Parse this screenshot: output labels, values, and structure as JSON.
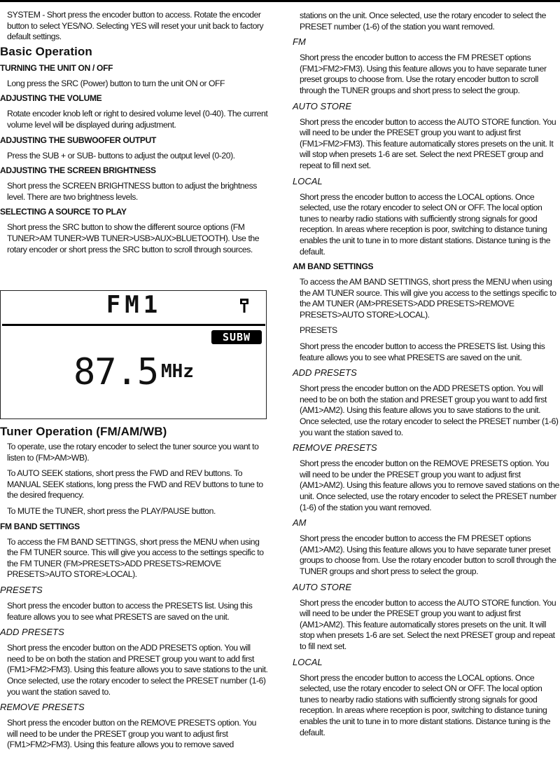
{
  "left": {
    "intro": "SYSTEM - Short press the encoder button to access. Rotate the encoder button to select YES/NO. Selecting YES will reset your unit back to factory default settings.",
    "basic_title": "Basic Operation",
    "basic": [
      {
        "heading": "TURNING THE UNIT ON / OFF",
        "text": "Long press the SRC (Power) button to turn the unit ON or OFF"
      },
      {
        "heading": "ADJUSTING THE VOLUME",
        "text": "Rotate encoder knob left or right to desired volume level (0-40). The current volume level will be displayed during adjustment."
      },
      {
        "heading": "ADJUSTING THE SUBWOOFER OUTPUT",
        "text": "Press the SUB + or SUB- buttons to adjust the output level (0-20)."
      },
      {
        "heading": "ADJUSTING THE SCREEN BRIGHTNESS",
        "text": "Short press the SCREEN BRIGHTNESS button to adjust the brightness level. There are two brightness levels."
      },
      {
        "heading": "SELECTING A SOURCE TO PLAY",
        "text": "Short press the SRC button to show the different source options (FM TUNER>AM TUNER>WB TUNER>USB>AUX>BLUETOOTH). Use the rotary encoder or short press the SRC button to scroll through sources."
      }
    ],
    "lcd": {
      "band": "FM1",
      "badge": "SUBW",
      "frequency": "87.5",
      "unit": "MHz",
      "antenna_icon": "antenna-icon"
    },
    "tuner_title": "Tuner Operation (FM/AM/WB)",
    "tuner_paras": [
      "To operate, use the rotary encoder to select the tuner source you want to listen to (FM>AM>WB).",
      "To AUTO SEEK stations, short press the FWD and REV buttons. To MANUAL SEEK stations, long press the FWD and REV buttons to tune to the desired frequency.",
      "To MUTE the TUNER, short press the PLAY/PAUSE button."
    ],
    "fm_band_heading": "FM BAND SETTINGS",
    "fm_band_text": "To access the FM BAND SETTINGS, short press the MENU when using the FM TUNER source. This will give you access to the settings specific to the FM TUNER (FM>PRESETS>ADD PRESETS>REMOVE PRESETS>AUTO STORE>LOCAL).",
    "fm_sections": [
      {
        "heading": "PRESETS",
        "text": "Short press the encoder button to access the PRESETS list. Using this feature allows you to see what PRESETS are saved on the unit."
      },
      {
        "heading": "ADD PRESETS",
        "text": "Short press the encoder button on the ADD PRESETS option. You will need to be on both the station and PRESET group you want to add first (FM1>FM2>FM3). Using this feature allows you to save stations to the unit. Once selected, use the rotary encoder to select the PRESET number (1-6) you want the station saved to."
      },
      {
        "heading": "REMOVE PRESETS",
        "text": "Short press the encoder button on the  REMOVE PRESETS option. You will need to be under the PRESET group you want to adjust first (FM1>FM2>FM3). Using this feature allows you to remove saved"
      }
    ]
  },
  "right": {
    "continued": "stations on the unit. Once selected, use the rotary encoder to select the PRESET number (1-6) of the station you want removed.",
    "fm_sections": [
      {
        "heading": "FM",
        "text": "Short press the encoder button to access the FM PRESET options (FM1>FM2>FM3). Using this feature allows you to have separate tuner preset groups to choose from. Use the rotary encoder button to scroll through the TUNER groups and short press to select the group."
      },
      {
        "heading": "AUTO STORE",
        "text": "Short press the encoder button to access the AUTO STORE function. You will need to be under the PRESET group you want to adjust first (FM1>FM2>FM3). This feature automatically stores presets on the unit. It will stop when presets 1-6 are set. Select the next PRESET group and repeat to fill next set."
      },
      {
        "heading": "LOCAL",
        "text": "Short press the encoder button to access the LOCAL options. Once selected, use the rotary encoder to select ON or OFF. The local option tunes to nearby radio stations with sufficiently strong signals for good reception. In areas where reception is poor, switching to distance tuning enables the unit to tune in to more distant stations. Distance tuning is the default."
      }
    ],
    "am_band_heading": "AM BAND SETTINGS",
    "am_band_text": "To access the AM BAND SETTINGS, short press the MENU when using the AM TUNER source. This will give you access to the settings specific to the AM TUNER (AM>PRESETS>ADD PRESETS>REMOVE PRESETS>AUTO STORE>LOCAL).",
    "am_presets_label": "PRESETS",
    "am_presets_text": "Short press the encoder button to access the PRESETS list. Using this feature allows you to see what PRESETS are saved on the unit.",
    "am_sections": [
      {
        "heading": "ADD PRESETS",
        "text": "Short press the encoder button on the ADD PRESETS option. You will need to be on both the station and PRESET group you want to add first (AM1>AM2). Using this feature allows you to save stations to the unit. Once selected, use the rotary encoder to select the PRESET number (1-6) you want the station saved to."
      },
      {
        "heading": "REMOVE PRESETS",
        "text": "Short press the encoder button on the  REMOVE PRESETS option. You will need to be under the PRESET group you want to adjust first (AM1>AM2). Using this feature allows you to remove saved stations on the unit. Once selected, use the rotary encoder to select the PRESET number (1-6) of the station you want removed."
      },
      {
        "heading": "AM",
        "text": "Short press the encoder button to access the FM PRESET options (AM1>AM2). Using this feature allows you to have separate tuner preset groups to choose from. Use the rotary encoder button to scroll through the TUNER groups and short press to select the group."
      },
      {
        "heading": "AUTO STORE",
        "text": "Short press the encoder button to access the AUTO STORE function. You will need to be under the PRESET group you want to adjust first (AM1>AM2). This feature automatically stores presets on the unit. It will stop when presets 1-6 are set. Select the next PRESET group and repeat to fill next set."
      },
      {
        "heading": "LOCAL",
        "text": "Short press the encoder button to access the LOCAL options. Once selected, use the rotary encoder to select ON or OFF. The local option tunes to nearby radio stations with sufficiently strong signals for good reception. In areas where reception is poor, switching to distance tuning enables the unit to tune in to more distant stations. Distance tuning is the default."
      }
    ]
  }
}
